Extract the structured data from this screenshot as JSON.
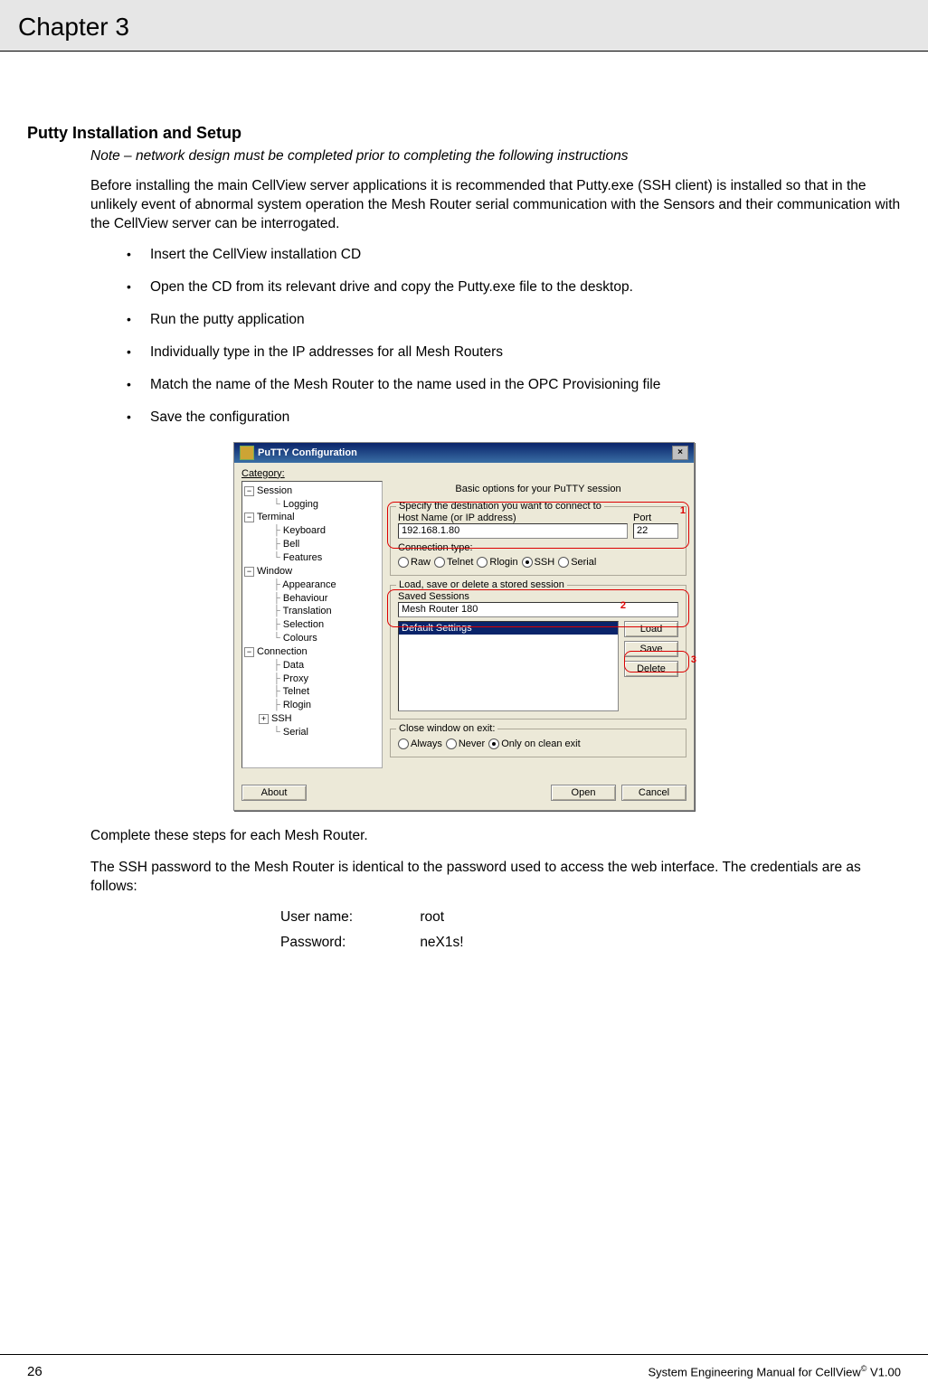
{
  "chapter": "Chapter 3",
  "section_title": "Putty Installation and Setup",
  "note": "Note – network design must be completed prior to completing the following instructions",
  "intro": "Before installing the main CellView server applications it is recommended that Putty.exe (SSH client) is installed so that in the unlikely event of abnormal system operation the Mesh Router serial communication with the Sensors and their communication with the CellView server can be interrogated.",
  "bullets": [
    "Insert the CellView installation CD",
    "Open the CD from its relevant drive and copy the Putty.exe file to the desktop.",
    "Run the putty application",
    "Individually type in the IP addresses for all Mesh Routers",
    "Match the name of the Mesh Router to the name used in the OPC Provisioning file",
    "Save the configuration"
  ],
  "after1": "Complete these steps for each Mesh Router.",
  "after2": "The SSH password to the Mesh Router is identical to the password used to access the web interface. The credentials are as follows:",
  "creds": {
    "user_label": "User name:",
    "user_value": "root",
    "pass_label": "Password:",
    "pass_value": "neX1s!"
  },
  "footer": {
    "page": "26",
    "title_pre": "System Engineering Manual for CellView",
    "title_sup": "©",
    "title_post": " V1.00"
  },
  "putty": {
    "window_title": "PuTTY Configuration",
    "category_label": "Category:",
    "tree": {
      "session": "Session",
      "logging": "Logging",
      "terminal": "Terminal",
      "keyboard": "Keyboard",
      "bell": "Bell",
      "features": "Features",
      "window": "Window",
      "appearance": "Appearance",
      "behaviour": "Behaviour",
      "translation": "Translation",
      "selection": "Selection",
      "colours": "Colours",
      "connection": "Connection",
      "data": "Data",
      "proxy": "Proxy",
      "telnet": "Telnet",
      "rlogin": "Rlogin",
      "ssh": "SSH",
      "serial": "Serial"
    },
    "right_title": "Basic options for your PuTTY session",
    "dest_group": "Specify the destination you want to connect to",
    "host_label": "Host Name (or IP address)",
    "port_label": "Port",
    "host_value": "192.168.1.80",
    "port_value": "22",
    "conn_type_label": "Connection type:",
    "radios": {
      "raw": "Raw",
      "telnet": "Telnet",
      "rlogin": "Rlogin",
      "ssh": "SSH",
      "serial": "Serial"
    },
    "sessions_group": "Load, save or delete a stored session",
    "saved_label": "Saved Sessions",
    "saved_value": "Mesh Router 180",
    "list_default": "Default Settings",
    "btn_load": "Load",
    "btn_save": "Save",
    "btn_delete": "Delete",
    "close_group": "Close window on exit:",
    "close_always": "Always",
    "close_never": "Never",
    "close_clean": "Only on clean exit",
    "btn_about": "About",
    "btn_open": "Open",
    "btn_cancel": "Cancel",
    "callouts": {
      "c1": "1",
      "c2": "2",
      "c3": "3"
    }
  }
}
